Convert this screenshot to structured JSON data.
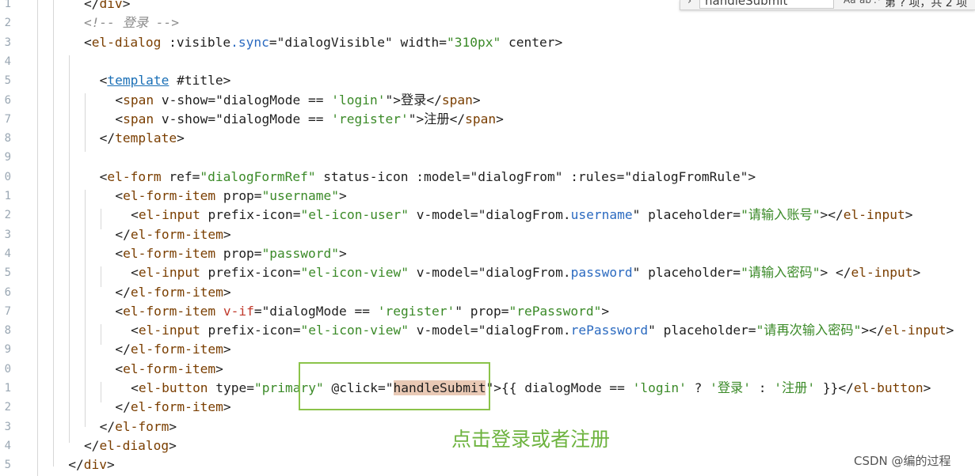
{
  "editor": {
    "line_numbers": [
      "1",
      "2",
      "3",
      "4",
      "5",
      "6",
      "7",
      "8",
      "9",
      "0",
      "1",
      "2",
      "3",
      "4",
      "5",
      "6",
      "7",
      "8",
      "9",
      "0",
      "1",
      "2",
      "3",
      "4",
      "5"
    ],
    "lines": [
      {
        "tokens": [
          {
            "t": "</",
            "c": "pu"
          },
          {
            "t": "div",
            "c": "tg"
          },
          {
            "t": ">",
            "c": "pu"
          }
        ]
      },
      {
        "tokens": [
          {
            "t": "<!-- 登录 -->",
            "c": "cm"
          }
        ]
      },
      {
        "tokens": [
          {
            "t": "<",
            "c": "pu"
          },
          {
            "t": "el-dialog",
            "c": "tg"
          },
          {
            "t": " ",
            "c": "tx"
          },
          {
            "t": ":visible",
            "c": "at"
          },
          {
            "t": ".sync",
            "c": "sb"
          },
          {
            "t": "=",
            "c": "pu"
          },
          {
            "t": "\"dialogVisible\"",
            "c": "tx"
          },
          {
            "t": " width=",
            "c": "at"
          },
          {
            "t": "\"310px\"",
            "c": "st"
          },
          {
            "t": " center",
            "c": "at"
          },
          {
            "t": ">",
            "c": "pu"
          }
        ]
      },
      {
        "tokens": []
      },
      {
        "tokens": [
          {
            "t": "<",
            "c": "pu"
          },
          {
            "t": "template",
            "c": "tgu"
          },
          {
            "t": " ",
            "c": "tx"
          },
          {
            "t": "#title",
            "c": "at"
          },
          {
            "t": ">",
            "c": "pu"
          }
        ]
      },
      {
        "tokens": [
          {
            "t": "<",
            "c": "pu"
          },
          {
            "t": "span",
            "c": "tg"
          },
          {
            "t": " v-show=",
            "c": "at"
          },
          {
            "t": "\"dialogMode == ",
            "c": "tx"
          },
          {
            "t": "'login'",
            "c": "st"
          },
          {
            "t": "\"",
            "c": "tx"
          },
          {
            "t": ">",
            "c": "pu"
          },
          {
            "t": "登录",
            "c": "tx"
          },
          {
            "t": "</",
            "c": "pu"
          },
          {
            "t": "span",
            "c": "tg"
          },
          {
            "t": ">",
            "c": "pu"
          }
        ]
      },
      {
        "tokens": [
          {
            "t": "<",
            "c": "pu"
          },
          {
            "t": "span",
            "c": "tg"
          },
          {
            "t": " v-show=",
            "c": "at"
          },
          {
            "t": "\"dialogMode == ",
            "c": "tx"
          },
          {
            "t": "'register'",
            "c": "st"
          },
          {
            "t": "\"",
            "c": "tx"
          },
          {
            "t": ">",
            "c": "pu"
          },
          {
            "t": "注册",
            "c": "tx"
          },
          {
            "t": "</",
            "c": "pu"
          },
          {
            "t": "span",
            "c": "tg"
          },
          {
            "t": ">",
            "c": "pu"
          }
        ]
      },
      {
        "tokens": [
          {
            "t": "</",
            "c": "pu"
          },
          {
            "t": "template",
            "c": "tg"
          },
          {
            "t": ">",
            "c": "pu"
          }
        ]
      },
      {
        "tokens": []
      },
      {
        "tokens": [
          {
            "t": "<",
            "c": "pu"
          },
          {
            "t": "el-form",
            "c": "tg"
          },
          {
            "t": " ref=",
            "c": "at"
          },
          {
            "t": "\"dialogFormRef\"",
            "c": "st"
          },
          {
            "t": " status-icon ",
            "c": "at"
          },
          {
            "t": ":model=",
            "c": "at"
          },
          {
            "t": "\"dialogFrom\"",
            "c": "tx"
          },
          {
            "t": " :rules=",
            "c": "at"
          },
          {
            "t": "\"dialogFromRule\"",
            "c": "tx"
          },
          {
            "t": ">",
            "c": "pu"
          }
        ]
      },
      {
        "tokens": [
          {
            "t": "<",
            "c": "pu"
          },
          {
            "t": "el-form-item",
            "c": "tg"
          },
          {
            "t": " prop=",
            "c": "at"
          },
          {
            "t": "\"username\"",
            "c": "st"
          },
          {
            "t": ">",
            "c": "pu"
          }
        ]
      },
      {
        "tokens": [
          {
            "t": "<",
            "c": "pu"
          },
          {
            "t": "el-input",
            "c": "tg"
          },
          {
            "t": " prefix-icon=",
            "c": "at"
          },
          {
            "t": "\"el-icon-user\"",
            "c": "st"
          },
          {
            "t": " v-model=",
            "c": "at"
          },
          {
            "t": "\"dialogFrom.",
            "c": "tx"
          },
          {
            "t": "username",
            "c": "sb"
          },
          {
            "t": "\"",
            "c": "tx"
          },
          {
            "t": " placeholder=",
            "c": "at"
          },
          {
            "t": "\"请输入账号\"",
            "c": "st"
          },
          {
            "t": "></",
            "c": "pu"
          },
          {
            "t": "el-input",
            "c": "tg"
          },
          {
            "t": ">",
            "c": "pu"
          }
        ]
      },
      {
        "tokens": [
          {
            "t": "</",
            "c": "pu"
          },
          {
            "t": "el-form-item",
            "c": "tg"
          },
          {
            "t": ">",
            "c": "pu"
          }
        ]
      },
      {
        "tokens": [
          {
            "t": "<",
            "c": "pu"
          },
          {
            "t": "el-form-item",
            "c": "tg"
          },
          {
            "t": " prop=",
            "c": "at"
          },
          {
            "t": "\"password\"",
            "c": "st"
          },
          {
            "t": ">",
            "c": "pu"
          }
        ]
      },
      {
        "tokens": [
          {
            "t": "<",
            "c": "pu"
          },
          {
            "t": "el-input",
            "c": "tg"
          },
          {
            "t": " prefix-icon=",
            "c": "at"
          },
          {
            "t": "\"el-icon-view\"",
            "c": "st"
          },
          {
            "t": " v-model=",
            "c": "at"
          },
          {
            "t": "\"dialogFrom.",
            "c": "tx"
          },
          {
            "t": "password",
            "c": "sb"
          },
          {
            "t": "\"",
            "c": "tx"
          },
          {
            "t": " placeholder=",
            "c": "at"
          },
          {
            "t": "\"请输入密码\"",
            "c": "st"
          },
          {
            "t": "> </",
            "c": "pu"
          },
          {
            "t": "el-input",
            "c": "tg"
          },
          {
            "t": ">",
            "c": "pu"
          }
        ]
      },
      {
        "tokens": [
          {
            "t": "</",
            "c": "pu"
          },
          {
            "t": "el-form-item",
            "c": "tg"
          },
          {
            "t": ">",
            "c": "pu"
          }
        ]
      },
      {
        "tokens": [
          {
            "t": "<",
            "c": "pu"
          },
          {
            "t": "el-form-item",
            "c": "tg"
          },
          {
            "t": " ",
            "c": "tx"
          },
          {
            "t": "v-if",
            "c": "kw"
          },
          {
            "t": "=",
            "c": "pu"
          },
          {
            "t": "\"dialogMode == ",
            "c": "tx"
          },
          {
            "t": "'register'",
            "c": "st"
          },
          {
            "t": "\"",
            "c": "tx"
          },
          {
            "t": " prop=",
            "c": "at"
          },
          {
            "t": "\"rePassword\"",
            "c": "st"
          },
          {
            "t": ">",
            "c": "pu"
          }
        ]
      },
      {
        "tokens": [
          {
            "t": "<",
            "c": "pu"
          },
          {
            "t": "el-input",
            "c": "tg"
          },
          {
            "t": " prefix-icon=",
            "c": "at"
          },
          {
            "t": "\"el-icon-view\"",
            "c": "st"
          },
          {
            "t": " v-model=",
            "c": "at"
          },
          {
            "t": "\"dialogFrom.",
            "c": "tx"
          },
          {
            "t": "rePassword",
            "c": "sb"
          },
          {
            "t": "\"",
            "c": "tx"
          },
          {
            "t": " placeholder=",
            "c": "at"
          },
          {
            "t": "\"请再次输入密码\"",
            "c": "st"
          },
          {
            "t": "></",
            "c": "pu"
          },
          {
            "t": "el-input",
            "c": "tg"
          },
          {
            "t": ">",
            "c": "pu"
          }
        ]
      },
      {
        "tokens": [
          {
            "t": "</",
            "c": "pu"
          },
          {
            "t": "el-form-item",
            "c": "tg"
          },
          {
            "t": ">",
            "c": "pu"
          }
        ]
      },
      {
        "tokens": [
          {
            "t": "<",
            "c": "pu"
          },
          {
            "t": "el-form-item",
            "c": "tg"
          },
          {
            "t": ">",
            "c": "pu"
          }
        ]
      },
      {
        "tokens": [
          {
            "t": "<",
            "c": "pu"
          },
          {
            "t": "el-button",
            "c": "tg"
          },
          {
            "t": " type=",
            "c": "at"
          },
          {
            "t": "\"primary\"",
            "c": "st"
          },
          {
            "t": " @click",
            "c": "at"
          },
          {
            "t": "=",
            "c": "pu"
          },
          {
            "t": "\"",
            "c": "tx"
          },
          {
            "t": "handleSubmit",
            "c": "hl"
          },
          {
            "t": "\"",
            "c": "tx"
          },
          {
            "t": ">",
            "c": "pu"
          },
          {
            "t": "{{",
            "c": "dl"
          },
          {
            "t": " dialogMode == ",
            "c": "tx"
          },
          {
            "t": "'login'",
            "c": "st"
          },
          {
            "t": " ? ",
            "c": "tx"
          },
          {
            "t": "'登录'",
            "c": "st"
          },
          {
            "t": " : ",
            "c": "tx"
          },
          {
            "t": "'注册'",
            "c": "st"
          },
          {
            "t": " }}",
            "c": "dl"
          },
          {
            "t": "</",
            "c": "pu"
          },
          {
            "t": "el-button",
            "c": "tg"
          },
          {
            "t": ">",
            "c": "pu"
          }
        ]
      },
      {
        "tokens": [
          {
            "t": "</",
            "c": "pu"
          },
          {
            "t": "el-form-item",
            "c": "tg"
          },
          {
            "t": ">",
            "c": "pu"
          }
        ]
      },
      {
        "tokens": [
          {
            "t": "</",
            "c": "pu"
          },
          {
            "t": "el-form",
            "c": "tg"
          },
          {
            "t": ">",
            "c": "pu"
          }
        ]
      },
      {
        "tokens": [
          {
            "t": "</",
            "c": "pu"
          },
          {
            "t": "el-dialog",
            "c": "tg"
          },
          {
            "t": ">",
            "c": "pu"
          }
        ]
      },
      {
        "tokens": [
          {
            "t": "</",
            "c": "pu"
          },
          {
            "t": "div",
            "c": "tg"
          },
          {
            "t": ">",
            "c": "pu"
          }
        ]
      }
    ]
  },
  "find_widget": {
    "expand_icon": "chevron-right-icon",
    "search_value": "handleSubmit",
    "options": [
      "Aa",
      "ab",
      ".*"
    ],
    "result_text": "第 ? 项，共 2 项"
  },
  "annotation": {
    "text": "点击登录或者注册",
    "color": "#8bc34a"
  },
  "watermark": {
    "text": "CSDN @编的过程"
  }
}
